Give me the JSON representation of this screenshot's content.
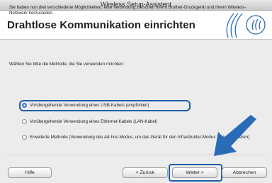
{
  "window": {
    "title": "Wireless Setup-Assistent"
  },
  "header": {
    "title": "Drahtlose Kommunikation einrichten"
  },
  "content": {
    "intro": "Sie haben nun drei verschiedene Möglichkeiten, eine Verbindung zwischen Ihrem Brother-Druckgerät und Ihrem Wireless-Netzwerk herzustellen.",
    "choose": "Wählen Sie bitte die Methode, die Sie verwenden möchten:",
    "options": [
      {
        "label": "Vorübergehende Verwendung eines USB-Kabels (empfohlen)",
        "selected": true
      },
      {
        "label": "Vorübergehende Verwendung eines Ethernet-Kabels (LAN-Kabel)",
        "selected": false
      },
      {
        "label": "Erweiterte Methode (Verwendung des Ad-hoc-Modus, um das Gerät für den Infrastruktur-Modus zu konfigurieren)",
        "selected": false
      }
    ]
  },
  "buttons": {
    "help": "Hilfe",
    "back": "< Zurück",
    "next": "Weiter >",
    "cancel": "Abbrechen"
  },
  "colors": {
    "highlight": "#1d5fa8",
    "arrow": "#2a6bb8",
    "logo": "#2a6bb8"
  },
  "icons": {
    "logo": "wireless-signal-logo",
    "arrow": "pointer-arrow"
  }
}
